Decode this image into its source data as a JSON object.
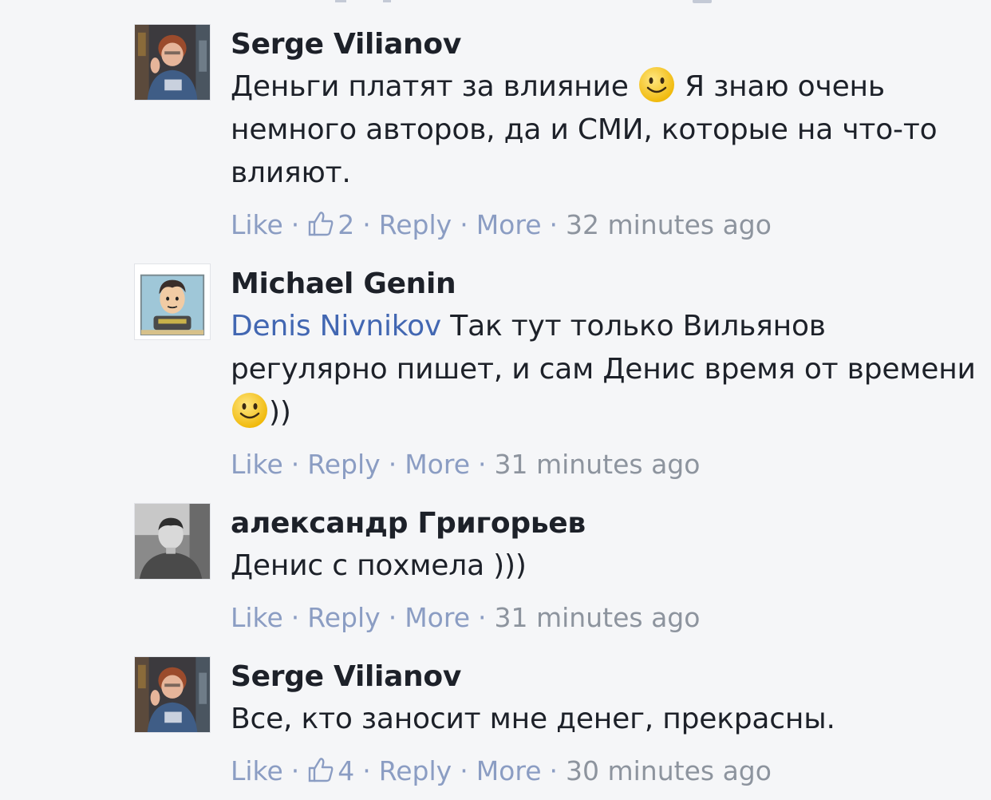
{
  "comments": [
    {
      "author": "Serge Vilianov",
      "avatar_icon": "user-photo-icon",
      "text_before_emoji": "Деньги платят за влияние ",
      "emoji": "smile-emoji",
      "text_after_emoji": " Я знаю очень немного авторов, да и СМИ, которые на что-то влияют.",
      "like_label": "Like",
      "like_count": "2",
      "reply_label": "Reply",
      "more_label": "More",
      "time": "32 minutes ago"
    },
    {
      "author": "Michael Genin",
      "avatar_icon": "cartoon-avatar-icon",
      "mention": "Denis Nivnikov",
      "text_before_emoji": " Так тут только Вильянов регулярно пишет, и сам Денис время от времени ",
      "emoji": "smile-emoji",
      "text_after_emoji": "))",
      "like_label": "Like",
      "reply_label": "Reply",
      "more_label": "More",
      "time": "31 minutes ago"
    },
    {
      "author": "александр Григорьев",
      "avatar_icon": "user-photo-icon",
      "text": "Денис с похмела )))",
      "like_label": "Like",
      "reply_label": "Reply",
      "more_label": "More",
      "time": "31 minutes ago"
    },
    {
      "author": "Serge Vilianov",
      "avatar_icon": "user-photo-icon",
      "text": "Все, кто заносит мне денег, прекрасны.",
      "like_label": "Like",
      "like_count": "4",
      "reply_label": "Reply",
      "more_label": "More",
      "time": "30 minutes ago"
    }
  ],
  "colors": {
    "background": "#f5f6f8",
    "text": "#1d2129",
    "link": "#8b9dc3",
    "mention": "#4267b2",
    "timestamp": "#8d949e"
  }
}
